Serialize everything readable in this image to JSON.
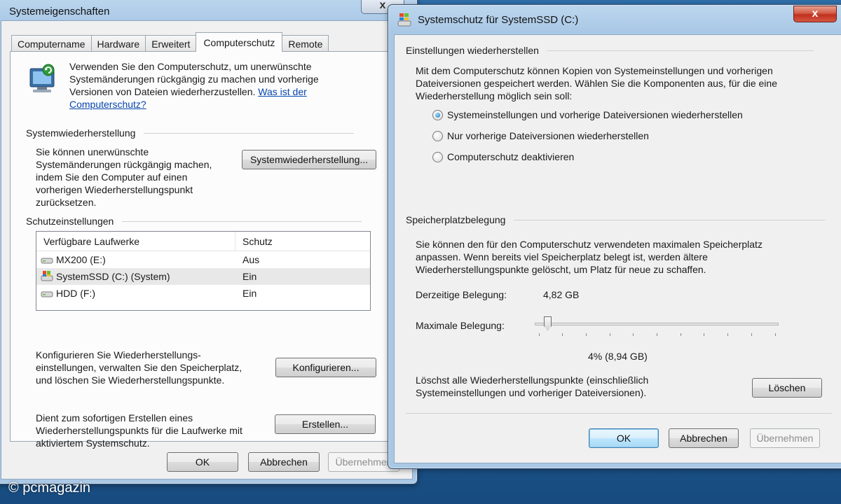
{
  "left_window": {
    "title": "Systemeigenschaften",
    "close_glyph": "x",
    "tabs": [
      {
        "label": "Computername"
      },
      {
        "label": "Hardware"
      },
      {
        "label": "Erweitert"
      },
      {
        "label": "Computerschutz",
        "active": true
      },
      {
        "label": "Remote"
      }
    ],
    "intro": {
      "line1": "Verwenden Sie den Computerschutz, um unerwünschte",
      "line2": "Systemänderungen rückgängig zu machen und vorherige",
      "line3": "Versionen von Dateien wiederherzustellen.",
      "link_part1": "Was ist der",
      "link_part2": "Computerschutz?"
    },
    "restore_section": {
      "title": "Systemwiederherstellung",
      "line1": "Sie können unerwünschte",
      "line2": "Systemänderungen rückgängig machen,",
      "line3": "indem Sie den Computer auf einen",
      "line4": "vorherigen Wiederherstellungspunkt",
      "line5": "zurücksetzen.",
      "button": "Systemwiederherstellung..."
    },
    "protection_section": {
      "title": "Schutzeinstellungen",
      "columns": [
        "Verfügbare Laufwerke",
        "Schutz"
      ],
      "drives": [
        {
          "name": "MX200 (E:)",
          "protection": "Aus",
          "icon": "hard-drive-icon"
        },
        {
          "name": "SystemSSD (C:) (System)",
          "protection": "Ein",
          "icon": "system-drive-icon"
        },
        {
          "name": "HDD (F:)",
          "protection": "Ein",
          "icon": "hard-drive-icon"
        }
      ],
      "configure_line1": "Konfigurieren Sie Wiederherstellungs-",
      "configure_line2": "einstellungen, verwalten Sie den Speicherplatz,",
      "configure_line3": "und löschen Sie Wiederherstellungspunkte.",
      "configure_button": "Konfigurieren...",
      "create_line1": "Dient zum sofortigen Erstellen eines",
      "create_line2": "Wiederherstellungspunkts für die Laufwerke mit",
      "create_line3": "aktiviertem Systemschutz.",
      "create_button": "Erstellen..."
    },
    "buttons": {
      "ok": "OK",
      "cancel": "Abbrechen",
      "apply": "Übernehmen"
    }
  },
  "right_window": {
    "title": "Systemschutz für SystemSSD (C:)",
    "close_glyph": "x",
    "restore_settings": {
      "title": "Einstellungen wiederherstellen",
      "line1": "Mit dem Computerschutz können Kopien von Systemeinstellungen und vorherigen",
      "line2": "Dateiversionen gespeichert werden. Wählen Sie die Komponenten aus, für die eine",
      "line3": "Wiederherstellung möglich sein soll:",
      "options": [
        {
          "label": "Systemeinstellungen und vorherige Dateiversionen wiederherstellen",
          "checked": true
        },
        {
          "label": "Nur vorherige Dateiversionen wiederherstellen",
          "checked": false
        },
        {
          "label": "Computerschutz deaktivieren",
          "checked": false
        }
      ]
    },
    "disk_space": {
      "title": "Speicherplatzbelegung",
      "line1": "Sie können den für den Computerschutz verwendeten maximalen Speicherplatz",
      "line2": "anpassen. Wenn bereits viel Speicherplatz belegt ist, werden ältere",
      "line3": "Wiederherstellungspunkte gelöscht, um Platz für neue zu schaffen.",
      "current_label": "Derzeitige Belegung:",
      "current_value": "4,82 GB",
      "max_label": "Maximale Belegung:",
      "slider_percent": 4,
      "max_value": "4% (8,94 GB)",
      "delete_line1": "Löschst alle Wiederherstellungspunkte (einschließlich",
      "delete_line2": "Systemeinstellungen und vorheriger Dateiversionen).",
      "delete_button": "Löschen"
    },
    "buttons": {
      "ok": "OK",
      "cancel": "Abbrechen",
      "apply": "Übernehmen"
    }
  },
  "watermark": "© pcmagazin"
}
